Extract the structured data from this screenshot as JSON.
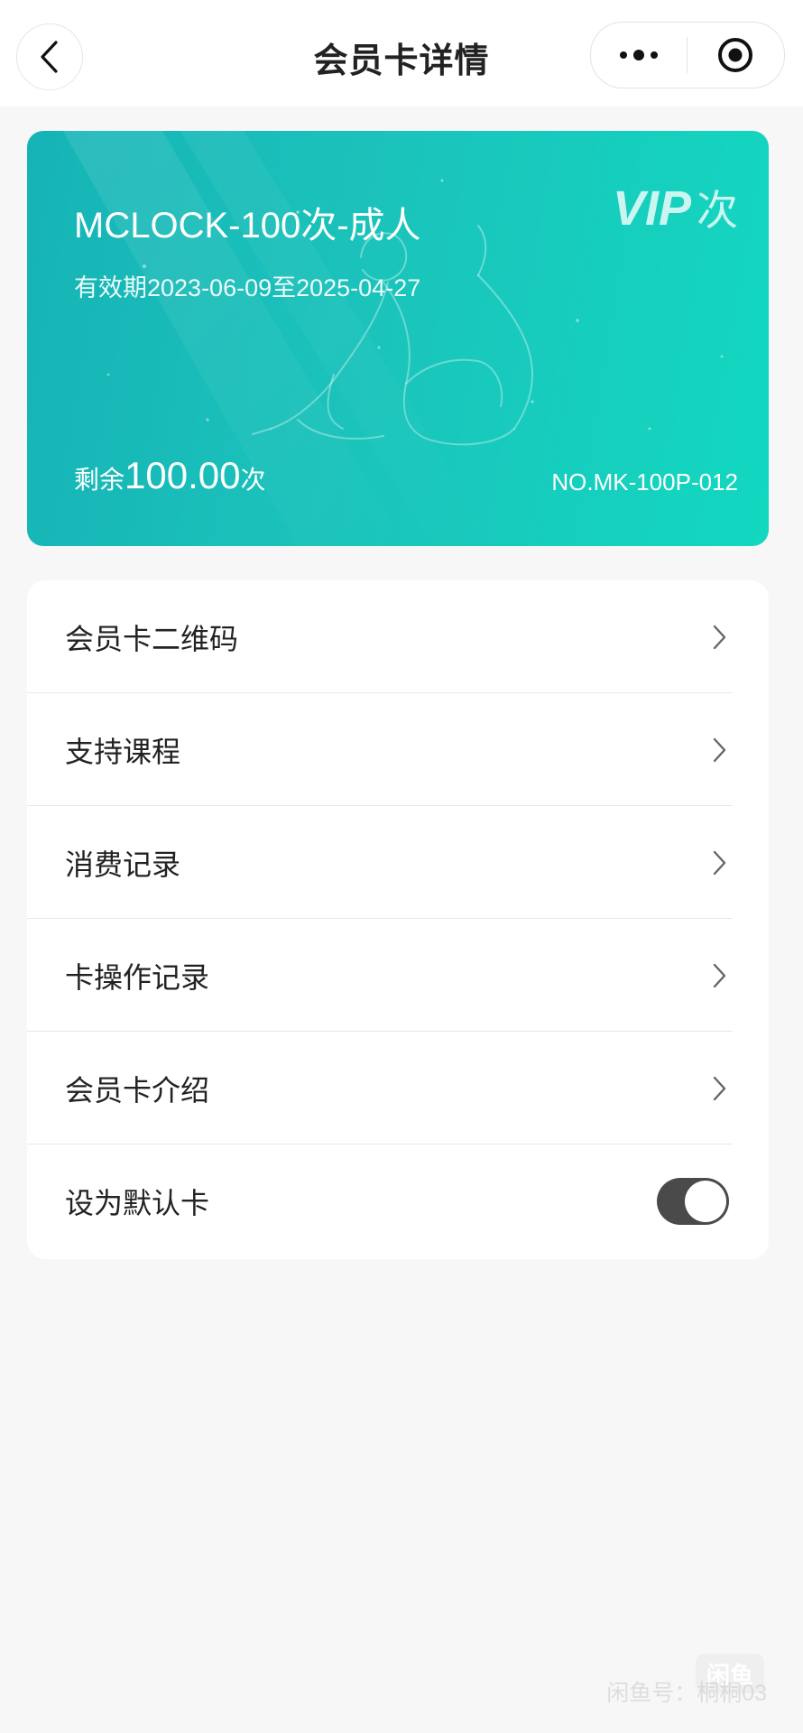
{
  "header": {
    "title": "会员卡详情",
    "back_icon": "chevron-left-icon",
    "menu_icon": "more-dots-icon",
    "target_icon": "target-icon"
  },
  "card": {
    "name": "MCLOCK-100次-成人",
    "validity": "有效期2023-06-09至2025-04-27",
    "vip_text": "VIP",
    "vip_unit": "次",
    "balance_label": "剩余",
    "balance_value": "100.00",
    "balance_unit": "次",
    "card_no": "NO.MK-100P-012",
    "gradient_start": "#16b3b6",
    "gradient_end": "#12d8c0"
  },
  "menu": {
    "items": [
      {
        "label": "会员卡二维码"
      },
      {
        "label": "支持课程"
      },
      {
        "label": "消费记录"
      },
      {
        "label": "卡操作记录"
      },
      {
        "label": "会员卡介绍"
      }
    ],
    "default_card": {
      "label": "设为默认卡",
      "enabled": true
    }
  },
  "watermark": {
    "logo": "闲鱼",
    "text": "闲鱼号：桐桐03"
  }
}
